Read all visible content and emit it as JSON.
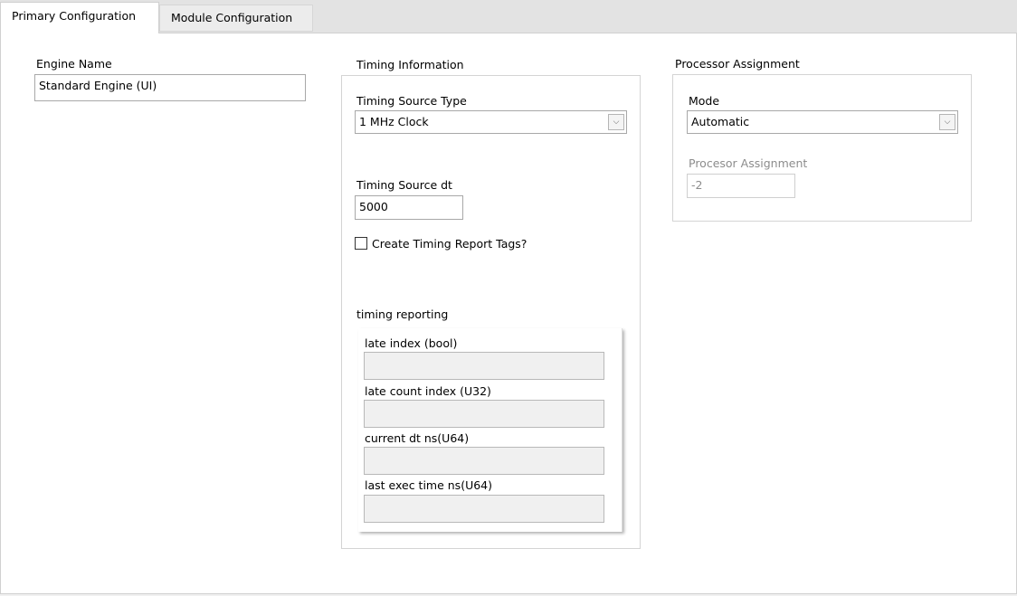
{
  "tabs": [
    {
      "label": "Primary Configuration",
      "active": true
    },
    {
      "label": "Module Configuration",
      "active": false
    }
  ],
  "engine": {
    "label": "Engine Name",
    "value": "Standard Engine (UI)"
  },
  "timing": {
    "title": "Timing Information",
    "source_type_label": "Timing Source Type",
    "source_type_value": "1 MHz Clock",
    "dt_label": "Timing Source dt",
    "dt_value": "5000",
    "create_tags_label": "Create Timing Report Tags?",
    "create_tags_checked": false,
    "reporting": {
      "title": "timing reporting",
      "fields": [
        {
          "label": "late index (bool)",
          "value": ""
        },
        {
          "label": "late count index (U32)",
          "value": ""
        },
        {
          "label": "current dt ns(U64)",
          "value": ""
        },
        {
          "label": "last exec time ns(U64)",
          "value": ""
        }
      ]
    }
  },
  "processor": {
    "title": "Processor Assignment",
    "mode_label": "Mode",
    "mode_value": "Automatic",
    "assignment_label": "Procesor Assignment",
    "assignment_value": "-2"
  },
  "icons": {
    "dropdown": "chevron-down-icon"
  }
}
